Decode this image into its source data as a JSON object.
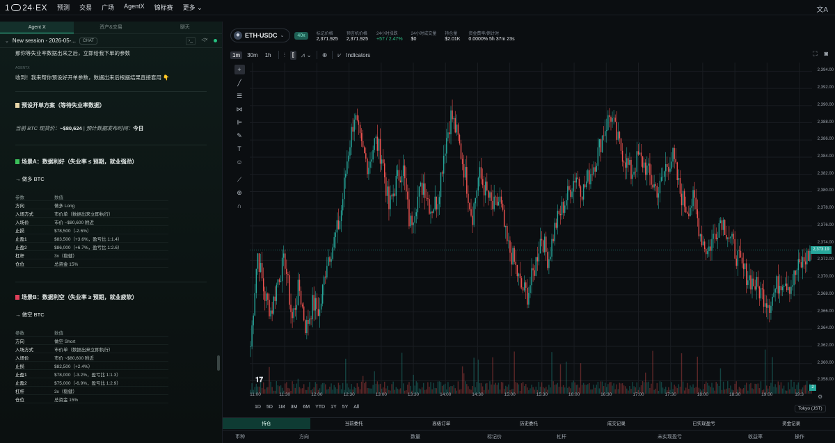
{
  "nav": {
    "logo_prefix": "1",
    "logo_text": "24·EX",
    "items": [
      "预测",
      "交易",
      "广场",
      "AgentX",
      "锦标赛",
      "更多 ⌄"
    ],
    "translate_icon": "translate-icon"
  },
  "left": {
    "tabs": [
      "Agent X",
      "资产&交易",
      "聊天"
    ],
    "session_title": "New session - 2026-05-...",
    "session_chip": "CHAT",
    "chat": {
      "prev_line": "那你等失业率数据出来之后，立即给我下单的参数",
      "sender": "AGENTX",
      "reply": "收到！我来帮你预设好开单参数，数据出来后根据结果直接套用 👇",
      "plan_title": "预设开单方案（等待失业率数据）",
      "context_prefix": "当前 BTC 现货价：",
      "context_price": "~$80,624",
      "context_mid": " | 预计数据发布时间：",
      "context_time": "今日",
      "scenario_a": {
        "title": "场景A：数据利好（失业率 ≤ 预期，就业强劲）",
        "action": "→ 做多 BTC",
        "header": [
          "参数",
          "数值"
        ],
        "rows": [
          [
            "方向",
            "做多 Long"
          ],
          [
            "入场方式",
            "市价单（数据出来立即执行）"
          ],
          [
            "入场价",
            "市价 ~$80,600 附近"
          ],
          [
            "止损",
            "$78,500（-2.6%）"
          ],
          [
            "止盈1",
            "$83,500（+3.6%，盈亏比 1:1.4）"
          ],
          [
            "止盈2",
            "$86,000（+6.7%，盈亏比 1:2.6）"
          ],
          [
            "杠杆",
            "3x（稳健）"
          ],
          [
            "仓位",
            "总资金 15%"
          ]
        ]
      },
      "scenario_b": {
        "title": "场景B：数据利空（失业率 ≥ 预期，就业疲软）",
        "action": "→ 做空 BTC",
        "header": [
          "参数",
          "数值"
        ],
        "rows": [
          [
            "方向",
            "做空 Short"
          ],
          [
            "入场方式",
            "市价单（数据出来立即执行）"
          ],
          [
            "入场价",
            "市价 ~$80,600 附近"
          ],
          [
            "止损",
            "$82,500（+2.4%）"
          ],
          [
            "止盈1",
            "$78,000（-3.2%，盈亏比 1:1.3）"
          ],
          [
            "止盈2",
            "$75,000（-6.9%，盈亏比 1:2.9）"
          ],
          [
            "杠杆",
            "3x（稳健）"
          ],
          [
            "仓位",
            "总资金 15%"
          ]
        ]
      }
    }
  },
  "market": {
    "symbol": "ETH-USDC",
    "leverage": "40x",
    "stats": [
      {
        "k": "标记价格",
        "v": "2,371.925",
        "up": false
      },
      {
        "k": "预言机价格",
        "v": "2,371.925",
        "up": false
      },
      {
        "k": "24小时涨跌",
        "v": "+57 / 2.47%",
        "up": true
      },
      {
        "k": "24小时成交量",
        "v": "$0",
        "up": false
      },
      {
        "k": "持仓量",
        "v": "$2.01K",
        "up": false
      },
      {
        "k": "资金费率/倒计时",
        "v": "0.0000%  5h 37m 23s",
        "up": false
      }
    ]
  },
  "toolbar": {
    "timeframes": [
      "1m",
      "30m",
      "1h"
    ],
    "active_tf": "1m",
    "indicators_label": "Indicators"
  },
  "chart_data": {
    "type": "candlestick",
    "price_ticks": [
      2394,
      2392,
      2390,
      2388,
      2386,
      2384,
      2382,
      2380,
      2378,
      2376,
      2374,
      2372,
      2370,
      2368,
      2366,
      2364,
      2362,
      2360,
      2358
    ],
    "ylim": [
      2356.5,
      2395
    ],
    "current_price": "2,373.19",
    "time_ticks": [
      "11:00",
      "11:30",
      "12:00",
      "12:30",
      "13:00",
      "13:30",
      "14:00",
      "14:30",
      "15:00",
      "15:30",
      "16:00",
      "16:30",
      "17:00",
      "17:30",
      "18:00",
      "18:30",
      "19:00",
      "19:3"
    ],
    "volume_tag": "2",
    "path": [
      2362,
      2373,
      2368,
      2366,
      2370,
      2372,
      2365,
      2369,
      2364,
      2367,
      2366,
      2372,
      2374,
      2377,
      2384,
      2389,
      2385,
      2383,
      2386,
      2384,
      2378,
      2381,
      2383,
      2376,
      2379,
      2381,
      2378,
      2379,
      2385,
      2389,
      2386,
      2382,
      2377,
      2382,
      2380,
      2378,
      2379,
      2374,
      2372,
      2369,
      2368,
      2371,
      2375,
      2372,
      2376,
      2378,
      2380,
      2382,
      2380,
      2382,
      2384,
      2387,
      2389,
      2386,
      2384,
      2382,
      2384,
      2383,
      2381,
      2380,
      2383,
      2384,
      2380,
      2378,
      2379,
      2375,
      2373,
      2375,
      2377,
      2375,
      2373,
      2371,
      2370,
      2369,
      2368,
      2367,
      2369,
      2370,
      2369,
      2371,
      2372,
      2373
    ]
  },
  "ranges": [
    "1D",
    "5D",
    "1M",
    "3M",
    "6M",
    "YTD",
    "1Y",
    "5Y",
    "All"
  ],
  "timezone": "Tokyo (JST)",
  "bottom": {
    "tabs": [
      "持仓",
      "当前委托",
      "高级订单",
      "历史委托",
      "成交记录",
      "已实现盈亏",
      "资金记录"
    ],
    "active": 0,
    "headers": [
      "币种",
      "方向",
      "数量",
      "标记价",
      "杠杆",
      "未实现盈亏",
      "收益率",
      "操作"
    ]
  },
  "colors": {
    "up": "#26a69a",
    "down": "#ef5350",
    "accent": "#2bd4a0"
  }
}
